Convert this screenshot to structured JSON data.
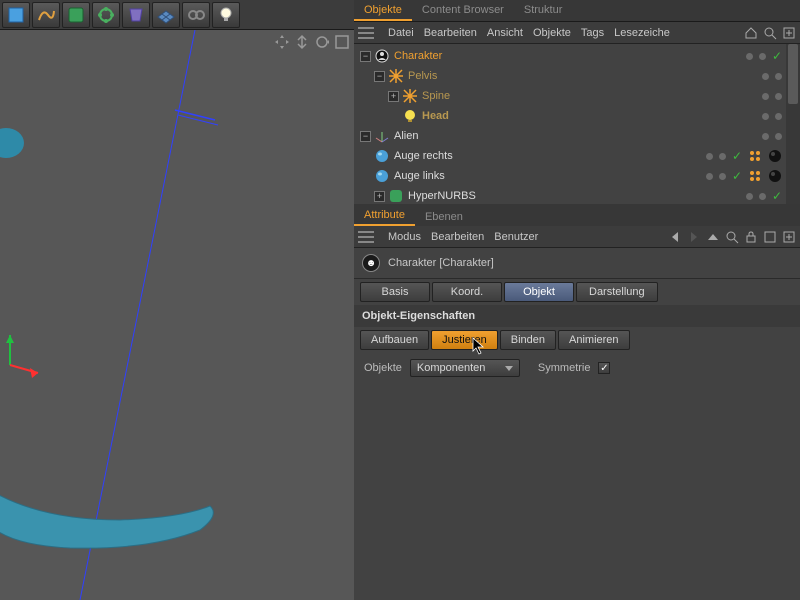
{
  "top_tabs": {
    "objects": "Objekte",
    "content_browser": "Content Browser",
    "structure": "Struktur"
  },
  "obj_menu": {
    "file": "Datei",
    "edit": "Bearbeiten",
    "view": "Ansicht",
    "objects": "Objekte",
    "tags": "Tags",
    "bookmarks": "Lesezeiche"
  },
  "tree": {
    "character": "Charakter",
    "pelvis": "Pelvis",
    "spine": "Spine",
    "head": "Head",
    "alien": "Alien",
    "eye_right": "Auge rechts",
    "eye_left": "Auge links",
    "hypernurbs": "HyperNURBS"
  },
  "attr_tabs": {
    "attribute": "Attribute",
    "layers": "Ebenen"
  },
  "attr_menu": {
    "mode": "Modus",
    "edit": "Bearbeiten",
    "user": "Benutzer"
  },
  "object_name": "Charakter [Charakter]",
  "subtabs": {
    "basic": "Basis",
    "coord": "Koord.",
    "object": "Objekt",
    "display": "Darstellung"
  },
  "section": "Objekt-Eigenschaften",
  "modes": {
    "build": "Aufbauen",
    "adjust": "Justieren",
    "bind": "Binden",
    "animate": "Animieren"
  },
  "props": {
    "objects_label": "Objekte",
    "dropdown": "Komponenten",
    "symmetry_label": "Symmetrie"
  },
  "chart_data": null
}
